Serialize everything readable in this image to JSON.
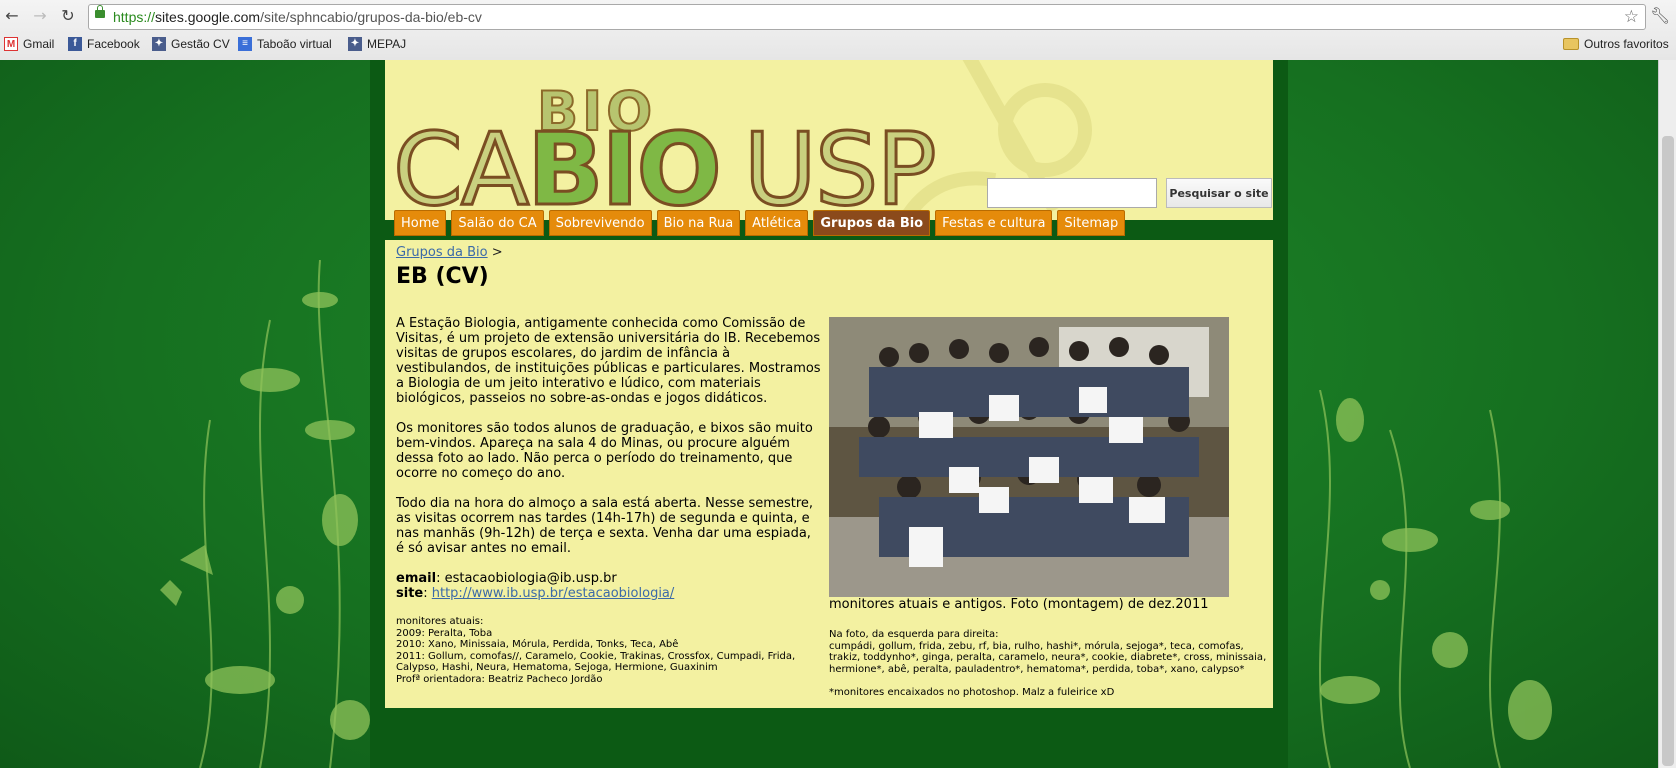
{
  "browser": {
    "url_scheme": "https://",
    "url_host": "sites.google.com",
    "url_path": "/site/sphncabio/grupos-da-bio/eb-cv",
    "bookmarks": [
      "Gmail",
      "Facebook",
      "Gestão CV",
      "Taboão virtual",
      "MEPAJ"
    ],
    "other_bookmarks": "Outros favoritos"
  },
  "header": {
    "logo_ca": "CA",
    "logo_bio": "BIO",
    "logo_usp": "USP",
    "logo_small": "BIO",
    "search_button": "Pesquisar o site"
  },
  "nav": {
    "tabs": [
      "Home",
      "Salão do CA",
      "Sobrevivendo",
      "Bio na Rua",
      "Atlética",
      "Grupos da Bio",
      "Festas e cultura",
      "Sitemap"
    ],
    "active": "Grupos da Bio"
  },
  "content": {
    "breadcrumb_link": "Grupos da Bio",
    "breadcrumb_sep": ">",
    "title": "EB (CV)",
    "paragraphs": [
      "A Estação Biologia, antigamente conhecida como Comissão de Visitas, é um projeto de extensão universitária do IB. Recebemos visitas de grupos escolares, do jardim de infância à vestibulandos, de instituições públicas e particulares. Mostramos a Biologia de um jeito interativo e lúdico, com materiais biológicos, passeios no sobre-as-ondas e jogos didáticos.",
      "Os monitores são todos alunos de graduação, e bixos são muito bem-vindos. Apareça na sala 4 do Minas, ou procure alguém dessa foto ao lado. Não perca o período do treinamento, que ocorre no começo do ano.",
      "Todo dia na hora do almoço a sala está aberta. Nesse semestre, as visitas ocorrem nas tardes (14h-17h) de segunda e quinta, e nas manhãs (9h-12h) de terça e sexta. Venha dar uma espiada, é só avisar antes no email."
    ],
    "email_label": "email",
    "email_value": ": estacaobiologia@ib.usp.br",
    "site_label": "site",
    "site_sep": ": ",
    "site_link": "http://www.ib.usp.br/estacaobiologia/",
    "monitors_text": "monitores atuais:\n2009: Peralta, Toba\n2010: Xano, Minissaia, Mórula, Perdida, Tonks, Teca, Abê\n2011: Gollum, comofas//, Caramelo, Cookie, Trakinas, Crossfox, Cumpadi, Frida, Calypso, Hashi, Neura, Hematoma, Sejoga, Hermione, Guaxinim\nProfª orientadora: Beatriz Pacheco Jordão",
    "photo_caption": "monitores atuais e antigos. Foto (montagem) de dez.2011",
    "photo_note": "Na foto, da esquerda para direita:\ncumpádi, gollum, frida, zebu, rf, bia, rulho, hashi*, mórula, sejoga*, teca, comofas, trakiz, toddynho*, ginga, peralta, caramelo, neura*, cookie, diabrete*, cross, minissaia, hermione*, abê, peralta, pauladentro*, hematoma*, perdida, toba*, xano, calypso*\n\n*monitores encaixados no photoshop. Malz a fuleirice xD"
  }
}
